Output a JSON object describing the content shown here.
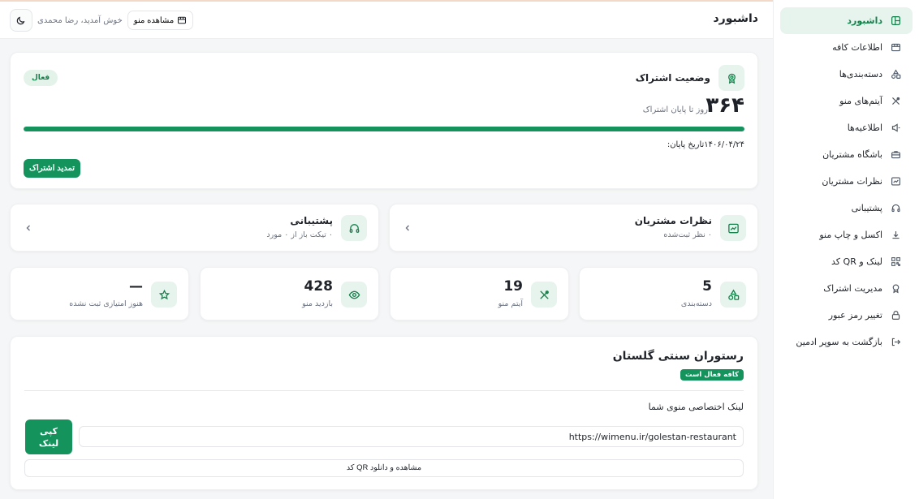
{
  "header": {
    "title": "داشبورد",
    "welcome": "خوش آمدید، رضا محمدی",
    "view_menu_label": "مشاهده منو"
  },
  "sidebar": {
    "items": [
      {
        "label": "داشبورد",
        "icon": "layout-icon",
        "active": true
      },
      {
        "label": "اطلاعات کافه",
        "icon": "store-icon"
      },
      {
        "label": "دسته‌بندی‌ها",
        "icon": "shapes-icon"
      },
      {
        "label": "آیتم‌های منو",
        "icon": "utensils-icon"
      },
      {
        "label": "اطلاعیه‌ها",
        "icon": "megaphone-icon"
      },
      {
        "label": "باشگاه مشتریان",
        "icon": "briefcase-icon"
      },
      {
        "label": "نظرات مشتریان",
        "icon": "chart-message-icon"
      },
      {
        "label": "پشتیبانی",
        "icon": "headset-icon"
      },
      {
        "label": "اکسل و چاپ منو",
        "icon": "download-icon"
      },
      {
        "label": "لینک و QR کد",
        "icon": "qr-icon"
      },
      {
        "label": "مدیریت اشتراک",
        "icon": "award-icon"
      },
      {
        "label": "تغییر رمز عبور",
        "icon": "lock-icon"
      },
      {
        "label": "بازگشت به سوپر ادمین",
        "icon": "logout-icon"
      }
    ]
  },
  "subscription": {
    "title": "وضعیت اشتراک",
    "status_badge": "فعال",
    "days_remaining": "۳۶۴",
    "days_label": "روز تا پایان اشتراک",
    "progress_percent": 100,
    "end_date_label": "تاریخ پایان:",
    "end_date": "۱۴۰۶/۰۴/۲۴",
    "renew_label": "تمدید اشتراک"
  },
  "wide_cards": {
    "reviews": {
      "title": "نظرات مشتریان",
      "subtitle": "۰ نظر ثبت‌شده"
    },
    "support": {
      "title": "پشتیبانی",
      "subtitle": "۰ تیکت باز از ۰ مورد"
    }
  },
  "stats": {
    "categories": {
      "value": "5",
      "label": "دسته‌بندی"
    },
    "menu_items": {
      "value": "19",
      "label": "آیتم منو"
    },
    "menu_views": {
      "value": "428",
      "label": "بازدید منو"
    },
    "rating": {
      "value": "—",
      "label": "هنوز امتیازی ثبت نشده"
    }
  },
  "cafe": {
    "name": "رستوران سنتی گلستان",
    "badge": "کافه فعال است",
    "link_label": "لینک اختصاصی منوی شما",
    "link_url": "https://wimenu.ir/golestan-restaurant",
    "copy_label": "کپی\nلینک",
    "qr_label": "مشاهده و دانلود QR کد"
  },
  "colors": {
    "accent": "#14935d",
    "accent_light": "#e7f4ee",
    "background": "#f5f6f7"
  }
}
